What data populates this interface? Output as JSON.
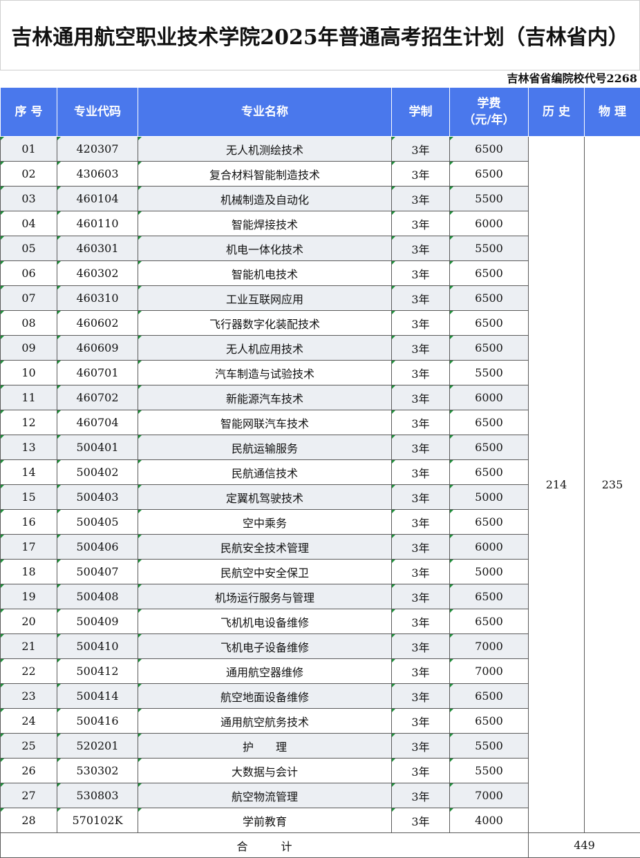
{
  "title": "吉林通用航空职业技术学院2025年普通高考招生计划（吉林省内）",
  "school_code": "吉林省省编院校代号2268",
  "headers": {
    "seq": "序 号",
    "code": "专业代码",
    "name": "专业名称",
    "duration": "学制",
    "tuition_line1": "学费",
    "tuition_line2": "（元/年）",
    "history": "历 史",
    "physics": "物 理"
  },
  "rows": [
    {
      "seq": "01",
      "code": "420307",
      "name": "无人机测绘技术",
      "duration": "3年",
      "fee": "6500"
    },
    {
      "seq": "02",
      "code": "430603",
      "name": "复合材料智能制造技术",
      "duration": "3年",
      "fee": "6500"
    },
    {
      "seq": "03",
      "code": "460104",
      "name": "机械制造及自动化",
      "duration": "3年",
      "fee": "5500"
    },
    {
      "seq": "04",
      "code": "460110",
      "name": "智能焊接技术",
      "duration": "3年",
      "fee": "6000"
    },
    {
      "seq": "05",
      "code": "460301",
      "name": "机电一体化技术",
      "duration": "3年",
      "fee": "5500"
    },
    {
      "seq": "06",
      "code": "460302",
      "name": "智能机电技术",
      "duration": "3年",
      "fee": "6500"
    },
    {
      "seq": "07",
      "code": "460310",
      "name": "工业互联网应用",
      "duration": "3年",
      "fee": "6500"
    },
    {
      "seq": "08",
      "code": "460602",
      "name": "飞行器数字化装配技术",
      "duration": "3年",
      "fee": "6500"
    },
    {
      "seq": "09",
      "code": "460609",
      "name": "无人机应用技术",
      "duration": "3年",
      "fee": "6500"
    },
    {
      "seq": "10",
      "code": "460701",
      "name": "汽车制造与试验技术",
      "duration": "3年",
      "fee": "5500"
    },
    {
      "seq": "11",
      "code": "460702",
      "name": "新能源汽车技术",
      "duration": "3年",
      "fee": "6000"
    },
    {
      "seq": "12",
      "code": "460704",
      "name": "智能网联汽车技术",
      "duration": "3年",
      "fee": "6500"
    },
    {
      "seq": "13",
      "code": "500401",
      "name": "民航运输服务",
      "duration": "3年",
      "fee": "6500"
    },
    {
      "seq": "14",
      "code": "500402",
      "name": "民航通信技术",
      "duration": "3年",
      "fee": "6500"
    },
    {
      "seq": "15",
      "code": "500403",
      "name": "定翼机驾驶技术",
      "duration": "3年",
      "fee": "5000"
    },
    {
      "seq": "16",
      "code": "500405",
      "name": "空中乘务",
      "duration": "3年",
      "fee": "6500"
    },
    {
      "seq": "17",
      "code": "500406",
      "name": "民航安全技术管理",
      "duration": "3年",
      "fee": "6000"
    },
    {
      "seq": "18",
      "code": "500407",
      "name": "民航空中安全保卫",
      "duration": "3年",
      "fee": "5000"
    },
    {
      "seq": "19",
      "code": "500408",
      "name": "机场运行服务与管理",
      "duration": "3年",
      "fee": "6500"
    },
    {
      "seq": "20",
      "code": "500409",
      "name": "飞机机电设备维修",
      "duration": "3年",
      "fee": "6500"
    },
    {
      "seq": "21",
      "code": "500410",
      "name": "飞机电子设备维修",
      "duration": "3年",
      "fee": "7000"
    },
    {
      "seq": "22",
      "code": "500412",
      "name": "通用航空器维修",
      "duration": "3年",
      "fee": "7000"
    },
    {
      "seq": "23",
      "code": "500414",
      "name": "航空地面设备维修",
      "duration": "3年",
      "fee": "6500"
    },
    {
      "seq": "24",
      "code": "500416",
      "name": "通用航空航务技术",
      "duration": "3年",
      "fee": "6500"
    },
    {
      "seq": "25",
      "code": "520201",
      "name": "护　　理",
      "duration": "3年",
      "fee": "5500"
    },
    {
      "seq": "26",
      "code": "530302",
      "name": "大数据与会计",
      "duration": "3年",
      "fee": "5500"
    },
    {
      "seq": "27",
      "code": "530803",
      "name": "航空物流管理",
      "duration": "3年",
      "fee": "7000"
    },
    {
      "seq": "28",
      "code": "570102K",
      "name": "学前教育",
      "duration": "3年",
      "fee": "4000"
    }
  ],
  "history_quota": "214",
  "physics_quota": "235",
  "total_label": "合　　　计",
  "total_value": "449"
}
